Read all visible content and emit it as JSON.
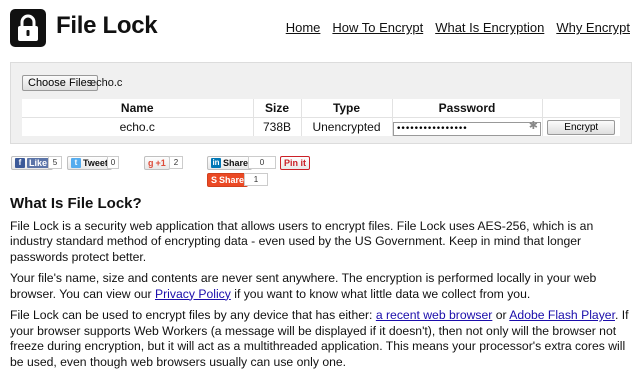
{
  "app": {
    "title": "File Lock"
  },
  "nav": [
    {
      "label": "Home"
    },
    {
      "label": "How To Encrypt"
    },
    {
      "label": "What Is Encryption"
    },
    {
      "label": "Why Encrypt"
    }
  ],
  "picker": {
    "button_label": "Choose Files",
    "file_name": "echo.c"
  },
  "table": {
    "headers": [
      "Name",
      "Size",
      "Type",
      "Password",
      ""
    ],
    "row": {
      "name": "echo.c",
      "size": "738B",
      "type": "Unencrypted",
      "password_mask": "••••••••••••••••",
      "action_label": "Encrypt"
    }
  },
  "social": {
    "fb": {
      "label": "Like",
      "count": "5"
    },
    "tw": {
      "label": "Tweet",
      "count": "0"
    },
    "gp": {
      "label": "+1",
      "count": "2"
    },
    "li": {
      "label": "Share",
      "count": "0"
    },
    "pin": {
      "label": "Pin it"
    },
    "su": {
      "label": "Share",
      "count": "1"
    }
  },
  "article": {
    "heading": "What Is File Lock?",
    "p1": "File Lock is a security web application that allows users to encrypt files. File Lock uses AES-256, which is an industry standard method of encrypting data - even used by the US Government. Keep in mind that longer passwords protect better.",
    "p2a": "Your file's name, size and contents are never sent anywhere. The encryption is performed locally in your web browser. You can view our ",
    "p2_link": "Privacy Policy",
    "p2b": " if you want to know what little data we collect from you.",
    "p3a": "File Lock can be used to encrypt files by any device that has either: ",
    "p3_link1": "a recent web browser",
    "p3_or": " or ",
    "p3_link2": "Adobe Flash Player",
    "p3b": ". If your browser supports Web Workers (a message will be displayed if it doesn't), then not only will the browser not freeze during encryption, but it will act as a multithreaded application. This means your processor's extra cores will be used, even though web browsers usually can use only one."
  },
  "colors": {
    "facebook": "#3b5998",
    "twitter": "#55acee",
    "googleplus": "#dd4b39",
    "linkedin": "#0077b5",
    "pinterest": "#cb2027",
    "stumble": "#eb4924",
    "link": "#1a0dab"
  }
}
